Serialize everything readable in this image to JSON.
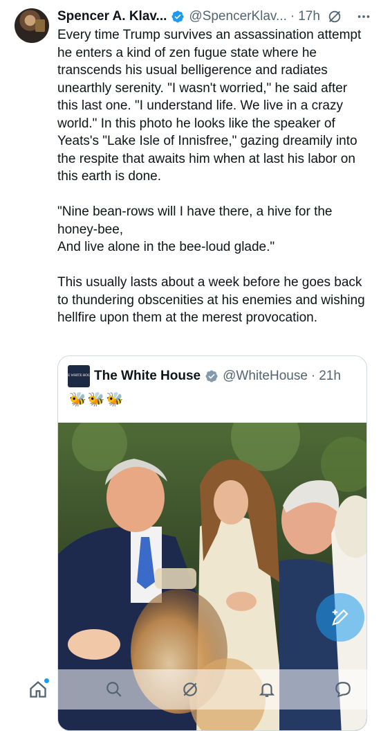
{
  "tweet": {
    "author_name": "Spencer A. Klav...",
    "handle": "@SpencerKlav...",
    "separator": "·",
    "time": "17h",
    "text": "Every time Trump survives an assassination attempt he enters a kind of zen fugue state where he transcends his usual belligerence and radiates unearthly serenity. \"I wasn't worried,\" he said after this last one. \"I understand life. We live in a crazy world.\" In this photo he looks like the speaker of Yeats's \"Lake Isle of Innisfree,\" gazing dreamily into the respite that awaits him when at last his labor on this earth is done.\n\n\"Nine bean-rows will I have there, a hive for the honey-bee,\nAnd live alone in the bee-loud glade.\"\n\nThis usually lasts about a week before he goes back to thundering obscenities at his enemies and wishing hellfire upon them at the merest provocation."
  },
  "quote": {
    "author_name": "The White House",
    "avatar_text": "THE WHITE HOUSE",
    "handle": "@WhiteHouse",
    "separator": "·",
    "time": "21h",
    "emoji": "🐝🐝🐝"
  },
  "icons": {
    "verified": "verified-badge-icon",
    "grok": "grok-icon",
    "more": "more-icon",
    "home": "home-icon",
    "search": "search-icon",
    "grok_nav": "grok-icon",
    "notifications": "bell-icon",
    "messages": "messages-icon",
    "compose": "compose-icon"
  },
  "colors": {
    "accent": "#1d9bf0",
    "text": "#0f1419",
    "secondary": "#536471",
    "border": "#cfd9de",
    "gov_badge": "#829aab"
  }
}
